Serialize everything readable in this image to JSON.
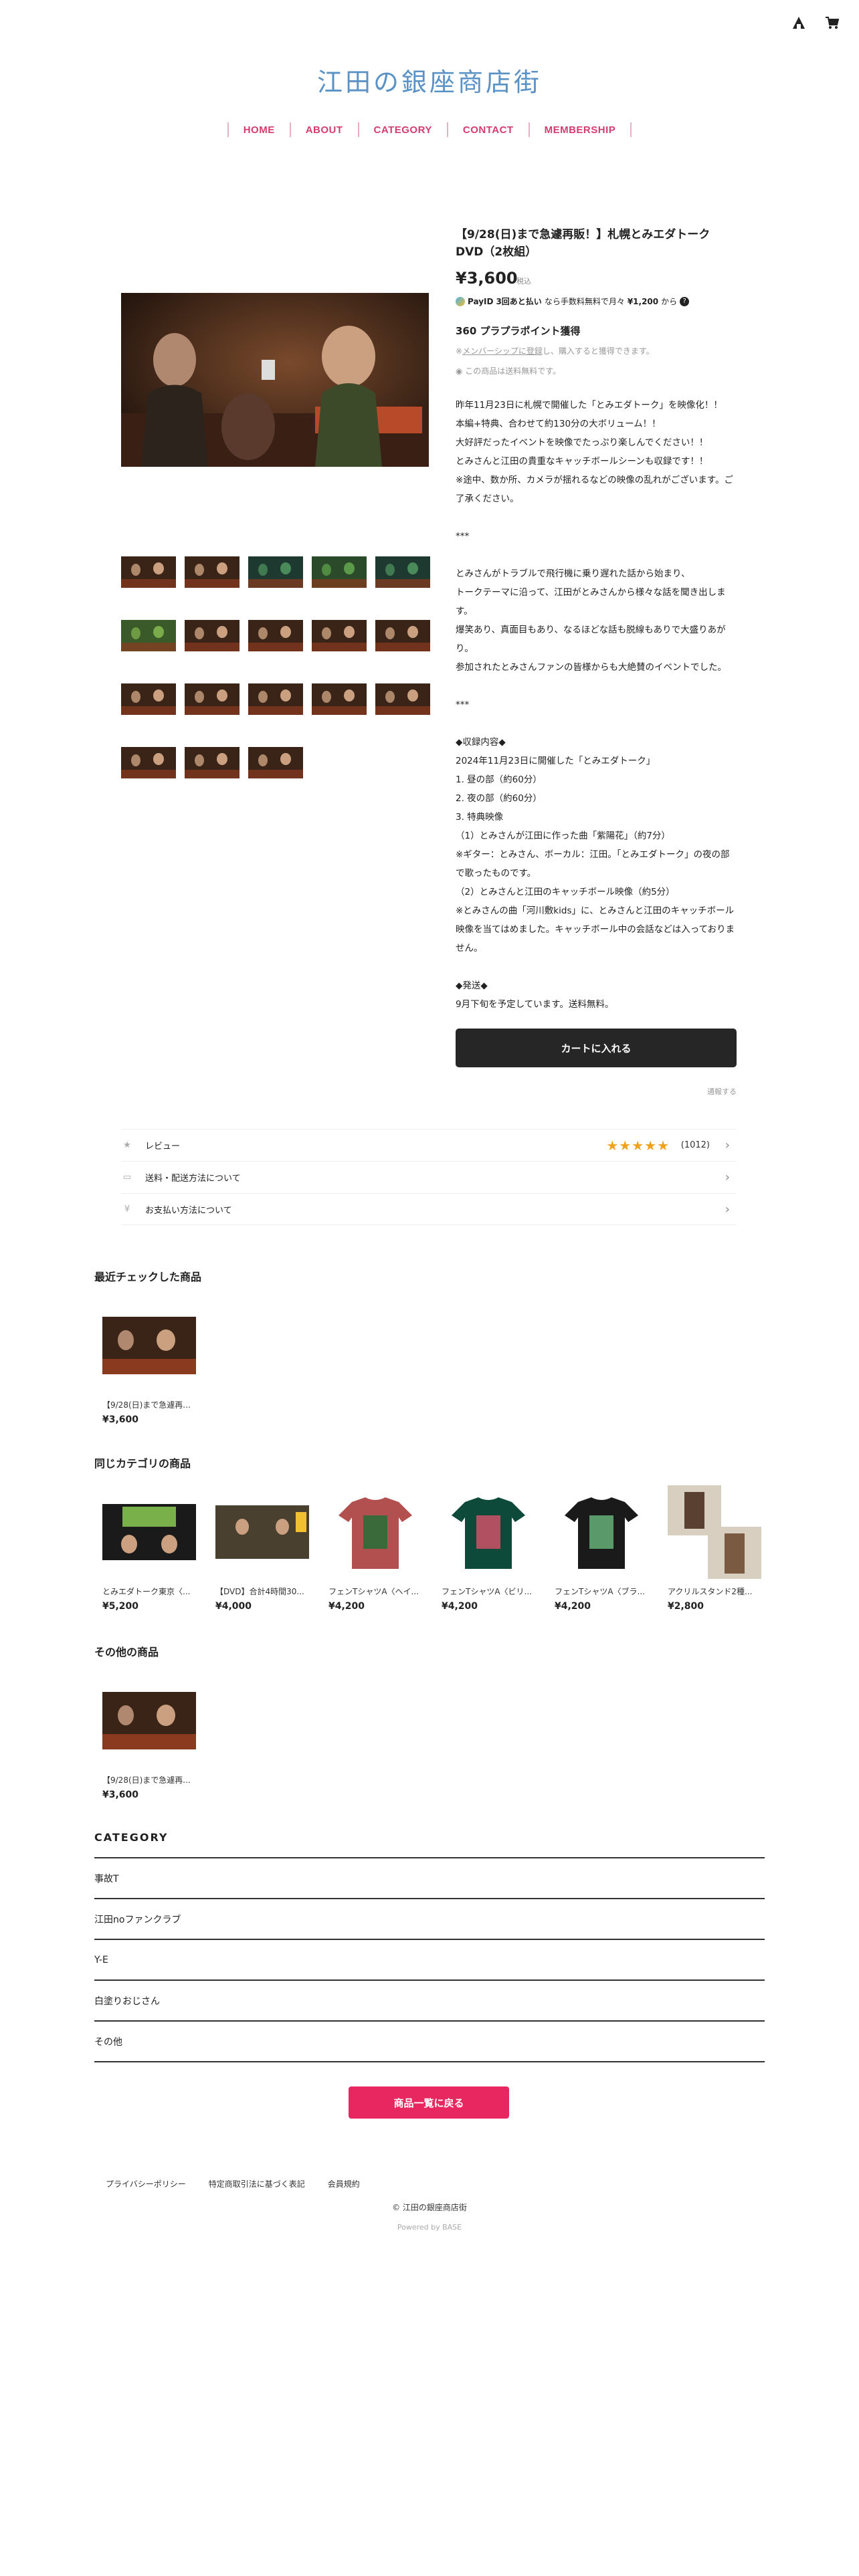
{
  "header": {
    "site_title": "江田の銀座商店街",
    "nav": [
      "HOME",
      "ABOUT",
      "CATEGORY",
      "CONTACT",
      "MEMBERSHIP"
    ]
  },
  "product": {
    "title": "【9/28(日)まで急遽再販！】札幌とみエダトークDVD（2枚組）",
    "price": "¥3,600",
    "tax_label": "税込",
    "payid_prefix": "PayID",
    "payid_text": "3回あと払い",
    "payid_suffix": "なら手数料無料で月々",
    "payid_amount": "¥1,200",
    "payid_tail": "から",
    "points": "360 プラプラポイント獲得",
    "member_note_link": "メンバーシップに登録",
    "member_note": "し、購入すると獲得できます。",
    "shipping_note": "この商品は送料無料です。",
    "description": [
      "昨年11月23日に札幌で開催した「とみエダトーク」を映像化！！",
      "本編+特典、合わせて約130分の大ボリューム！！",
      "大好評だったイベントを映像でたっぷり楽しんでください！！",
      "とみさんと江田の貴重なキャッチボールシーンも収録です！！",
      "※途中、数か所、カメラが揺れるなどの映像の乱れがございます。ご了承ください。",
      "",
      "***",
      "",
      "とみさんがトラブルで飛行機に乗り遅れた話から始まり、",
      "トークテーマに沿って、江田がとみさんから様々な話を聞き出します。",
      "爆笑あり、真面目もあり、なるほどな話も脱線もありで大盛りあがり。",
      "参加されたとみさんファンの皆様からも大絶賛のイベントでした。",
      "",
      "***",
      "",
      "◆収録内容◆",
      "2024年11月23日に開催した「とみエダトーク」",
      "1. 昼の部（約60分）",
      "2. 夜の部（約60分）",
      "3. 特典映像",
      "（1）とみさんが江田に作った曲「紫陽花」（約7分）",
      "※ギター：とみさん、ボーカル：江田。「とみエダトーク」の夜の部で歌ったものです。",
      "（2）とみさんと江田のキャッチボール映像（約5分）",
      "※とみさんの曲「河川敷kids」に、とみさんと江田のキャッチボール映像を当てはめました。キャッチボール中の会話などは入っておりません。",
      "",
      "◆発送◆",
      "9月下旬を予定しています。送料無料。"
    ],
    "cart_button": "カートに入れる",
    "report_link": "通報する"
  },
  "accordion": {
    "review_label": "レビュー",
    "review_stars": "★★★★★",
    "review_count": "(1012)",
    "shipping_label": "送料・配送方法について",
    "payment_label": "お支払い方法について"
  },
  "recent": {
    "title": "最近チェックした商品",
    "items": [
      {
        "name": "【9/28(日)まで急遽再...",
        "price": "¥3,600"
      }
    ]
  },
  "same_category": {
    "title": "同じカテゴリの商品",
    "items": [
      {
        "name": "とみエダトーク東京〈...",
        "price": "¥5,200"
      },
      {
        "name": "【DVD】合計4時間30...",
        "price": "¥4,000"
      },
      {
        "name": "フェンTシャツA〈ヘイ...",
        "price": "¥4,200"
      },
      {
        "name": "フェンTシャツA〈ビリ...",
        "price": "¥4,200"
      },
      {
        "name": "フェンTシャツA〈ブラ...",
        "price": "¥4,200"
      },
      {
        "name": "アクリルスタンド2種...",
        "price": "¥2,800"
      }
    ]
  },
  "other": {
    "title": "その他の商品",
    "items": [
      {
        "name": "【9/28(日)まで急遽再...",
        "price": "¥3,600"
      }
    ]
  },
  "category": {
    "title": "CATEGORY",
    "items": [
      "事故T",
      "江田noファンクラブ",
      "Y-E",
      "白塗りおじさん",
      "その他"
    ]
  },
  "back_button": "商品一覧に戻る",
  "footer": {
    "links": [
      "プライバシーポリシー",
      "特定商取引法に基づく表記",
      "会員規約"
    ],
    "copyright": "© 江田の銀座商店街",
    "powered": "Powered by  BASE"
  },
  "colors": {
    "title_blue": "#5b92c5",
    "nav_pink": "#d23d6e",
    "cart_dark": "#262626",
    "back_pink": "#e8265f",
    "star_gold": "#f0a21c"
  }
}
